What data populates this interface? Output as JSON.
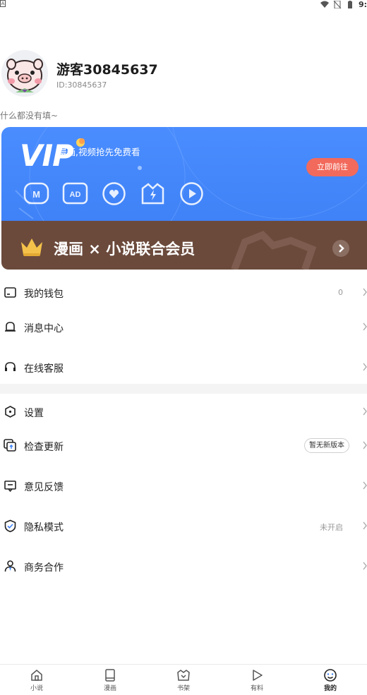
{
  "status_bar": {
    "left_badge": "A",
    "time": "9:"
  },
  "profile": {
    "username": "游客30845637",
    "user_id": "ID:30845637",
    "bio": "什么都没有填~"
  },
  "vip": {
    "badge": "VIP",
    "subtitle": "漫画,视频抢先免费看",
    "cta_label": "立即前往",
    "benefit_icons": [
      "m-badge-icon",
      "ad-free-icon",
      "heart-icon",
      "lightning-icon",
      "play-icon"
    ],
    "combo_title": "漫画 × 小说联合会员",
    "colors": {
      "blue": "#4a8dff",
      "brown": "#6b4a3c",
      "cta": "#f26a5c"
    }
  },
  "menu_group_1": [
    {
      "icon": "wallet-icon",
      "label": "我的钱包",
      "value": "0"
    },
    {
      "icon": "bell-icon",
      "label": "消息中心",
      "value": ""
    },
    {
      "icon": "headset-icon",
      "label": "在线客服",
      "value": ""
    }
  ],
  "menu_group_2": [
    {
      "icon": "settings-icon",
      "label": "设置",
      "value": ""
    },
    {
      "icon": "update-icon",
      "label": "检查更新",
      "badge": "暂无新版本"
    },
    {
      "icon": "feedback-icon",
      "label": "意见反馈",
      "value": ""
    },
    {
      "icon": "shield-icon",
      "label": "隐私模式",
      "value": "未开启"
    },
    {
      "icon": "business-icon",
      "label": "商务合作",
      "value": ""
    }
  ],
  "bottom_nav": [
    {
      "icon": "home-icon",
      "label": "小说"
    },
    {
      "icon": "book-icon",
      "label": "漫画"
    },
    {
      "icon": "bookshelf-icon",
      "label": "书架"
    },
    {
      "icon": "play-icon",
      "label": "有料"
    },
    {
      "icon": "smile-icon",
      "label": "我的",
      "active": true
    }
  ]
}
